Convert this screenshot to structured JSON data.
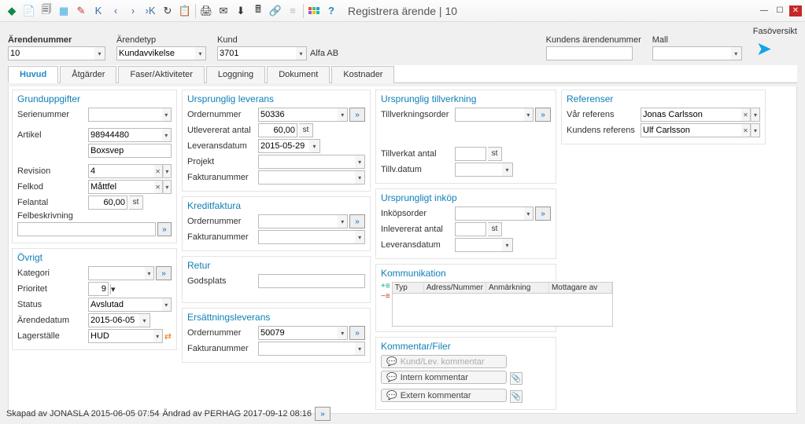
{
  "window": {
    "title": "Registrera ärende | 10"
  },
  "toolbar_icons": [
    "new",
    "copy",
    "grid",
    "pen",
    "first",
    "prev",
    "next",
    "last",
    "refresh",
    "paste",
    "print",
    "mail",
    "down",
    "calc",
    "link",
    "list",
    "apps",
    "help"
  ],
  "filters": {
    "arendenummer": {
      "label": "Ärendenummer",
      "value": "10"
    },
    "arendetyp": {
      "label": "Ärendetyp",
      "value": "Kundavvikelse"
    },
    "kund": {
      "label": "Kund",
      "value": "3701",
      "display": "Alfa AB"
    },
    "kundens_arendenummer": {
      "label": "Kundens ärendenummer",
      "value": ""
    },
    "mall": {
      "label": "Mall",
      "value": ""
    },
    "fasoversikt": {
      "label": "Fasöversikt"
    }
  },
  "tabs": [
    "Huvud",
    "Åtgärder",
    "Faser/Aktiviteter",
    "Loggning",
    "Dokument",
    "Kostnader"
  ],
  "grund": {
    "heading": "Grunduppgifter",
    "serienummer_label": "Serienummer",
    "serienummer": "",
    "artikel_label": "Artikel",
    "artikel": "98944480",
    "artikel_desc": "Boxsvep",
    "revision_label": "Revision",
    "revision": "4",
    "felkod_label": "Felkod",
    "felkod": "Måttfel",
    "felantal_label": "Felantal",
    "felantal": "60,00",
    "felantal_unit": "st",
    "felbeskrivning_label": "Felbeskrivning",
    "felbeskrivning": ""
  },
  "ovrigt": {
    "heading": "Övrigt",
    "kategori_label": "Kategori",
    "kategori": "",
    "prioritet_label": "Prioritet",
    "prioritet": "9",
    "status_label": "Status",
    "status": "Avslutad",
    "arendedatum_label": "Ärendedatum",
    "arendedatum": "2015-06-05",
    "lagerstalle_label": "Lagerställe",
    "lagerstalle": "HUD"
  },
  "ursprunglig_leverans": {
    "heading": "Ursprunglig leverans",
    "ordernummer_label": "Ordernummer",
    "ordernummer": "50336",
    "utlevererat_antal_label": "Utlevererat antal",
    "utlevererat_antal": "60,00",
    "unit": "st",
    "leveransdatum_label": "Leveransdatum",
    "leveransdatum": "2015-05-29",
    "projekt_label": "Projekt",
    "projekt": "",
    "fakturanummer_label": "Fakturanummer",
    "fakturanummer": ""
  },
  "kreditfaktura": {
    "heading": "Kreditfaktura",
    "ordernummer_label": "Ordernummer",
    "ordernummer": "",
    "fakturanummer_label": "Fakturanummer",
    "fakturanummer": ""
  },
  "retur": {
    "heading": "Retur",
    "godsplats_label": "Godsplats",
    "godsplats": ""
  },
  "ersattning": {
    "heading": "Ersättningsleverans",
    "ordernummer_label": "Ordernummer",
    "ordernummer": "50079",
    "fakturanummer_label": "Fakturanummer",
    "fakturanummer": ""
  },
  "tillverkning": {
    "heading": "Ursprunglig tillverkning",
    "tillverkningsorder_label": "Tillverkningsorder",
    "tillverkningsorder": "",
    "tillverkat_antal_label": "Tillverkat antal",
    "tillverkat_antal": "",
    "unit": "st",
    "tillvdatum_label": "Tillv.datum",
    "tillvdatum": ""
  },
  "inkop": {
    "heading": "Ursprungligt inköp",
    "inkopsorder_label": "Inköpsorder",
    "inkopsorder": "",
    "inlevererat_antal_label": "Inlevererat antal",
    "inlevererat_antal": "",
    "unit": "st",
    "leveransdatum_label": "Leveransdatum",
    "leveransdatum": ""
  },
  "kommunikation": {
    "heading": "Kommunikation",
    "cols": {
      "typ": "Typ",
      "adress": "Adress/Nummer",
      "anm": "Anmärkning",
      "mott": "Mottagare av"
    }
  },
  "kommentar": {
    "heading": "Kommentar/Filer",
    "kundlev": "Kund/Lev. kommentar",
    "intern": "Intern kommentar",
    "extern": "Extern kommentar"
  },
  "referenser": {
    "heading": "Referenser",
    "var_label": "Vår referens",
    "var": "Jonas Carlsson",
    "kund_label": "Kundens referens",
    "kund": "Ulf Carlsson"
  },
  "footer": {
    "skapad": "Skapad av JONASLA 2015-06-05 07:54",
    "andrad": "Ändrad av PERHAG 2017-09-12 08:16"
  }
}
